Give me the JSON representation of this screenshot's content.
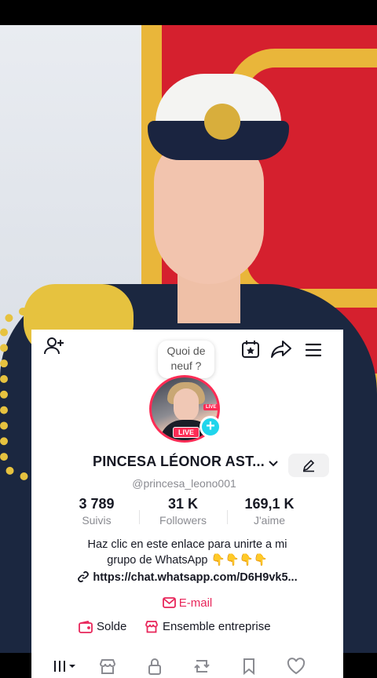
{
  "header": {
    "bubble_text": "Quoi de neuf ?"
  },
  "avatar": {
    "live_small": "LIVE",
    "live_label": "LIVE",
    "plus": "+"
  },
  "profile": {
    "display_name": "PINCESA LÉONOR AST...",
    "username": "@princesa_leono001"
  },
  "stats": [
    {
      "value": "3 789",
      "label": "Suivis"
    },
    {
      "value": "31 K",
      "label": "Followers"
    },
    {
      "value": "169,1 K",
      "label": "J'aime"
    }
  ],
  "bio": {
    "line1": "Haz clic en este enlace para unirte a mi",
    "line2": "grupo de WhatsApp 👇👇👇👇",
    "link": "https://chat.whatsapp.com/D6H9vk5...",
    "email_label": "E-mail"
  },
  "shop": {
    "balance_label": "Solde",
    "business_label": "Ensemble entreprise"
  },
  "colors": {
    "accent": "#fe2c55",
    "email": "#e8265a",
    "teal": "#20d5ec",
    "text": "#161823",
    "muted": "#8a8b91"
  }
}
